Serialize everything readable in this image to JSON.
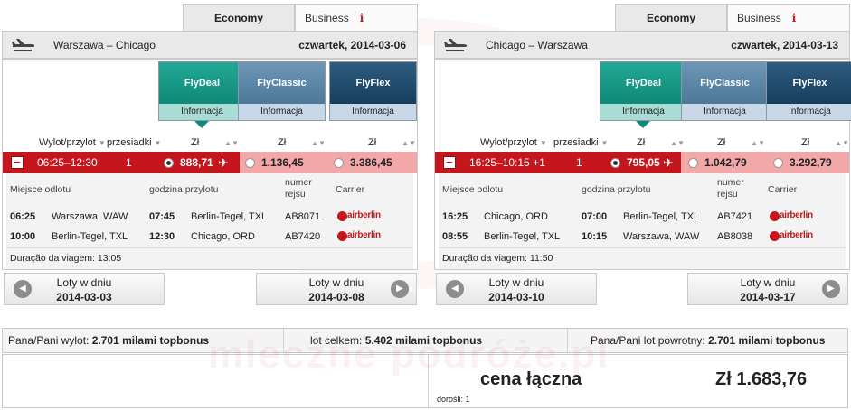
{
  "colors": {
    "brand_red": "#c4161c",
    "flydeal": "#0f8979",
    "flyclassic": "#4d7898",
    "flyflex": "#163e5c"
  },
  "panels": [
    {
      "tabs": {
        "economy": "Economy",
        "business": "Business",
        "info_mark": "i"
      },
      "route": "Warszawa – Chicago",
      "date": "czwartek, 2014-03-06",
      "fares": [
        {
          "name": "FlyDeal",
          "info": "Informacja"
        },
        {
          "name": "FlyClassic",
          "info": "Informacja"
        },
        {
          "name": "FlyFlex",
          "info": "Informacja"
        }
      ],
      "columns": {
        "depart_arrive": "Wylot/przylot",
        "stops": "przesiadki",
        "cur1": "Zł",
        "cur2": "Zł",
        "cur3": "Zł"
      },
      "row": {
        "times": "06:25–12:30",
        "stops": "1",
        "prices": [
          "888,71",
          "1.136,45",
          "3.386,45"
        ]
      },
      "details": {
        "headers": {
          "origin": "Miejsce odlotu",
          "arrival_time": "godzina przylotu",
          "flight_no": "numer\nrejsu",
          "carrier": "Carrier"
        },
        "legs": [
          {
            "dep": "06:25",
            "from": "Warszawa, WAW",
            "arr": "07:45",
            "to": "Berlin-Tegel, TXL",
            "flight": "AB8071",
            "carrier": "airberlin"
          },
          {
            "dep": "10:00",
            "from": "Berlin-Tegel, TXL",
            "arr": "12:30",
            "to": "Chicago, ORD",
            "flight": "AB7420",
            "carrier": "airberlin"
          }
        ],
        "duration": "Duração da viagem: 13:05"
      },
      "nav": {
        "prev_label": "Loty w dniu",
        "prev_date": "2014-03-03",
        "next_label": "Loty w dniu",
        "next_date": "2014-03-08"
      }
    },
    {
      "tabs": {
        "economy": "Economy",
        "business": "Business",
        "info_mark": "i"
      },
      "route": "Chicago – Warszawa",
      "date": "czwartek, 2014-03-13",
      "fares": [
        {
          "name": "FlyDeal",
          "info": "Informacja"
        },
        {
          "name": "FlyClassic",
          "info": "Informacja"
        },
        {
          "name": "FlyFlex",
          "info": "Informacja"
        }
      ],
      "columns": {
        "depart_arrive": "Wylot/przylot",
        "stops": "przesiadki",
        "cur1": "Zł",
        "cur2": "Zł",
        "cur3": "Zł"
      },
      "row": {
        "times": "16:25–10:15 +1",
        "stops": "1",
        "prices": [
          "795,05",
          "1.042,79",
          "3.292,79"
        ]
      },
      "details": {
        "headers": {
          "origin": "Miejsce odlotu",
          "arrival_time": "godzina przylotu",
          "flight_no": "numer\nrejsu",
          "carrier": "Carrier"
        },
        "legs": [
          {
            "dep": "16:25",
            "from": "Chicago, ORD",
            "arr": "07:00",
            "to": "Berlin-Tegel, TXL",
            "flight": "AB7421",
            "carrier": "airberlin"
          },
          {
            "dep": "08:55",
            "from": "Berlin-Tegel, TXL",
            "arr": "10:15",
            "to": "Warszawa, WAW",
            "flight": "AB8038",
            "carrier": "airberlin"
          }
        ],
        "duration": "Duração da viagem: 11:50"
      },
      "nav": {
        "prev_label": "Loty w dniu",
        "prev_date": "2014-03-10",
        "next_label": "Loty w dniu",
        "next_date": "2014-03-17"
      }
    }
  ],
  "bonus": {
    "out_label": "Pana/Pani wylot:",
    "out_value": "2.701 milami topbonus",
    "total_label": "lot celkem:",
    "total_value": "5.402 milami topbonus",
    "ret_label": "Pana/Pani lot powrotny:",
    "ret_value": "2.701 milami topbonus"
  },
  "summary": {
    "label": "cena łączna",
    "price": "Zł 1.683,76",
    "adults": "dorośli: 1"
  },
  "watermark": "mleczne podróże.pl"
}
